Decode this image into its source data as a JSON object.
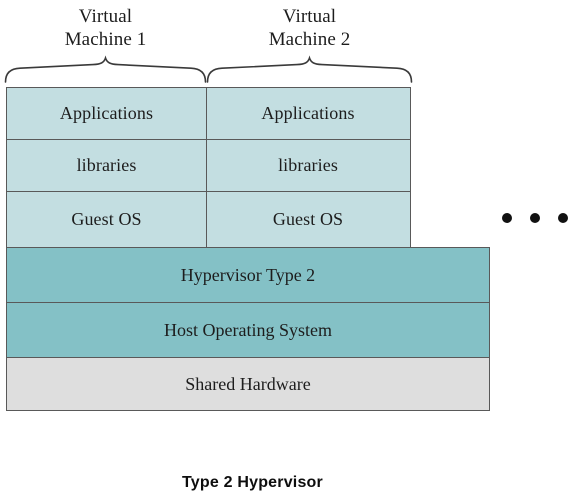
{
  "figure": {
    "caption": "Type 2 Hypervisor",
    "colors": {
      "guest_fill": "#c3dee1",
      "platform_fill": "#84c1c6",
      "hardware_fill": "#dedede",
      "border": "#595959",
      "dot": "#111111",
      "background": "#ffffff"
    }
  },
  "vm_labels": [
    {
      "line1": "Virtual",
      "line2": "Machine 1"
    },
    {
      "line1": "Virtual",
      "line2": "Machine 2"
    }
  ],
  "guest_rows": [
    {
      "name": "applications",
      "vm1": "Applications",
      "vm2": "Applications"
    },
    {
      "name": "libraries",
      "vm1": "libraries",
      "vm2": "libraries"
    },
    {
      "name": "guest-os",
      "vm1": "Guest OS",
      "vm2": "Guest OS"
    }
  ],
  "platform_rows": [
    {
      "name": "hypervisor",
      "label": "Hypervisor Type 2"
    },
    {
      "name": "host-os",
      "label": "Host Operating System"
    },
    {
      "name": "hardware",
      "label": "Shared Hardware"
    }
  ],
  "ellipsis": {
    "count": 3,
    "meaning": "additional virtual machines"
  }
}
